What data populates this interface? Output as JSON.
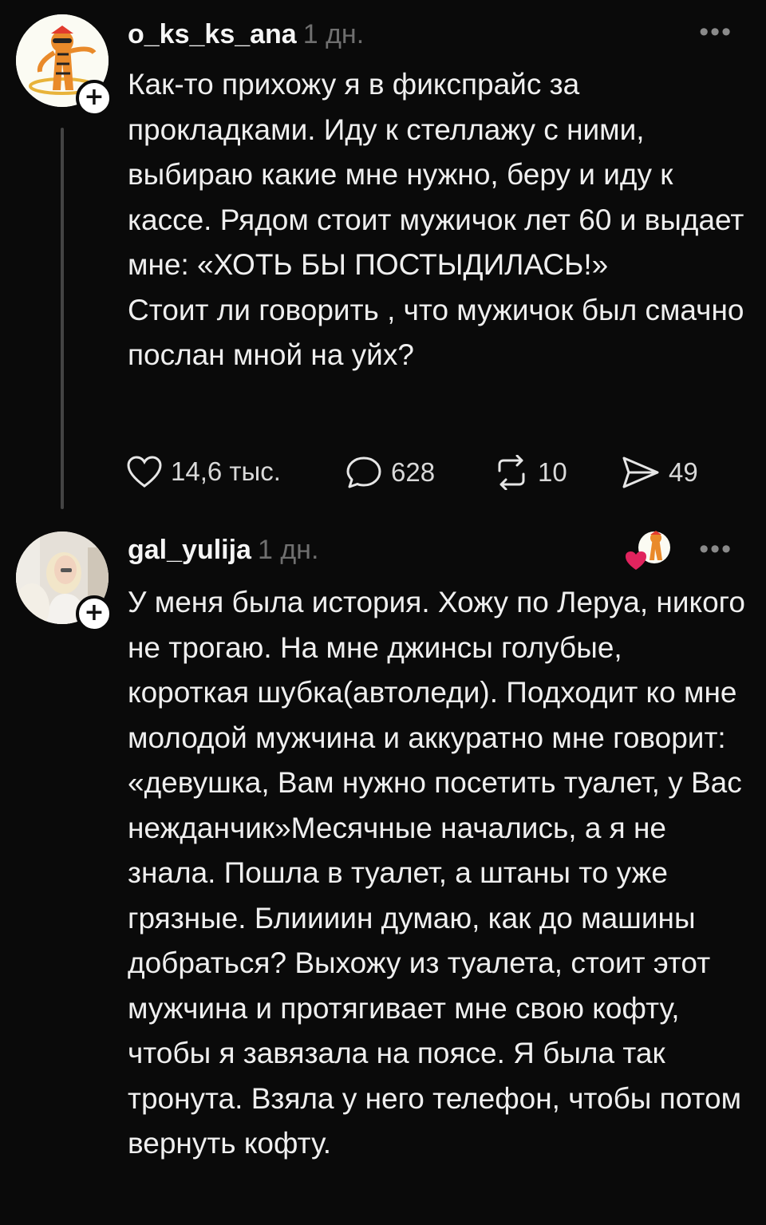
{
  "comments": [
    {
      "username": "o_ks_ks_ana",
      "age": "1 дн.",
      "more": "•••",
      "follow": "+",
      "paragraphs": [
        "Как-то прихожу я в фикспрайс за прокладками. Иду к стеллажу с ними, выбираю какие мне нужно, беру и иду к кассе. Рядом стоит мужичок лет 60 и выдает мне: «ХОТЬ БЫ ПОСТЫДИЛАСЬ!»",
        "Стоит ли говорить , что мужичок был смачно послан мной на уйх?"
      ],
      "actions": {
        "likes": "14,6 тыс.",
        "comments": "628",
        "reposts": "10",
        "shares": "49"
      }
    },
    {
      "username": "gal_yulija",
      "age": "1 дн.",
      "more": "•••",
      "follow": "+",
      "paragraphs": [
        "У меня была история. Хожу по Леруа, никого не трогаю. На мне джинсы голубые, короткая шубка(автоледи). Подходит ко мне молодой мужчина и аккуратно мне говорит: «девушка, Вам нужно посетить туалет, у Вас нежданчик»Месячные начались, а я не знала. Пошла в туалет, а штаны то уже грязные. Блиииин думаю, как до машины добраться? Выхожу из туалета, стоит этот мужчина и протягивает мне свою кофту, чтобы я завязала на поясе. Я была так тронута. Взяла у него телефон, чтобы потом вернуть кофту."
      ]
    }
  ],
  "icons": {
    "like": "heart-icon",
    "comment": "comment-bubble-icon",
    "repost": "repost-arrows-icon",
    "share": "send-icon",
    "liked_by_author": "author-liked-heart-icon"
  },
  "colors": {
    "background": "#0a0a0a",
    "text": "#efefef",
    "muted": "#6f6f6f",
    "like_heart": "#e0245e"
  }
}
